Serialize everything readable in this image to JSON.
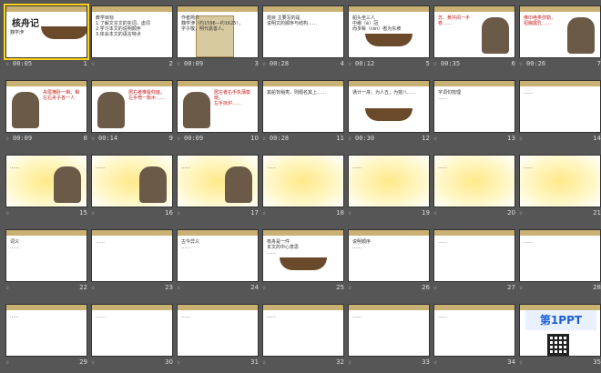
{
  "app": {
    "view": "Slide Sorter"
  },
  "slides": [
    {
      "n": "1",
      "time": "00:05",
      "lines": [
        "核舟记",
        "魏学洢"
      ],
      "style": "title"
    },
    {
      "n": "2",
      "time": "",
      "lines": [
        "教学目标",
        "1.了解文言文的实词、虚词",
        "2.学习本文的说明顺序",
        "3.体会本文的语言特点"
      ],
      "style": "list"
    },
    {
      "n": "3",
      "time": "00:09",
      "lines": [
        "作者简介",
        "魏学洢（约1596—约1625），",
        "字子敬，明代嘉善人。"
      ],
      "style": "scroll"
    },
    {
      "n": "4",
      "time": "00:28",
      "lines": [
        "题目 主要写的是",
        "说明文的顺序与结构……"
      ],
      "style": "list"
    },
    {
      "n": "5",
      "time": "00:12",
      "lines": [
        "船头坐三人",
        "中峨（é）冠",
        "而多髯（rán）者为东坡"
      ],
      "style": "boat"
    },
    {
      "n": "6",
      "time": "00:35",
      "lines": [
        "苏、黄共阅一手卷……"
      ],
      "style": "figure"
    },
    {
      "n": "7",
      "time": "00:26",
      "lines": [
        "佛印绝类弥勒，",
        "袒胸露乳……"
      ],
      "style": "figure"
    },
    {
      "n": "8",
      "time": "00:09",
      "lines": [
        "舟尾横卧一楫，楫左右舟子各一人"
      ],
      "style": "figureL"
    },
    {
      "n": "9",
      "time": "00:14",
      "lines": [
        "居右者椎髻仰面，",
        "左手倚一衡木……"
      ],
      "style": "figureL"
    },
    {
      "n": "10",
      "time": "00:09",
      "lines": [
        "居左者右手执蒲葵扇，",
        "左手抚炉……"
      ],
      "style": "figureL"
    },
    {
      "n": "11",
      "time": "00:28",
      "lines": [
        "其船背稍夷，则题名其上……"
      ],
      "style": "list"
    },
    {
      "n": "12",
      "time": "00:30",
      "lines": [
        "通计一舟，为人五；为窗八……"
      ],
      "style": "boat"
    },
    {
      "n": "13",
      "time": "",
      "lines": [
        "字词句梳理",
        "……"
      ],
      "style": "list"
    },
    {
      "n": "14",
      "time": "",
      "lines": [
        "……"
      ],
      "style": "list"
    },
    {
      "n": "15",
      "time": "",
      "lines": [
        "……"
      ],
      "style": "yellowFig"
    },
    {
      "n": "16",
      "time": "",
      "lines": [
        "……"
      ],
      "style": "yellowFig"
    },
    {
      "n": "17",
      "time": "",
      "lines": [
        "……"
      ],
      "style": "yellowFig"
    },
    {
      "n": "18",
      "time": "",
      "lines": [
        "……"
      ],
      "style": "yellow"
    },
    {
      "n": "19",
      "time": "",
      "lines": [
        "……"
      ],
      "style": "yellow"
    },
    {
      "n": "20",
      "time": "",
      "lines": [
        "……"
      ],
      "style": "yellow"
    },
    {
      "n": "21",
      "time": "",
      "lines": [
        "……"
      ],
      "style": "yellow"
    },
    {
      "n": "22",
      "time": "",
      "lines": [
        "词义",
        "……"
      ],
      "style": "list"
    },
    {
      "n": "23",
      "time": "",
      "lines": [
        "……"
      ],
      "style": "list"
    },
    {
      "n": "24",
      "time": "",
      "lines": [
        "古今异义",
        "……"
      ],
      "style": "list"
    },
    {
      "n": "25",
      "time": "",
      "lines": [
        "核舟是一件",
        "本文的中心意思",
        "……"
      ],
      "style": "boatBig"
    },
    {
      "n": "26",
      "time": "",
      "lines": [
        "说明顺序",
        "……"
      ],
      "style": "list"
    },
    {
      "n": "27",
      "time": "",
      "lines": [
        "……"
      ],
      "style": "list"
    },
    {
      "n": "28",
      "time": "",
      "lines": [
        "……"
      ],
      "style": "list"
    },
    {
      "n": "29",
      "time": "",
      "lines": [
        "……"
      ],
      "style": "list"
    },
    {
      "n": "30",
      "time": "",
      "lines": [
        "……"
      ],
      "style": "list"
    },
    {
      "n": "31",
      "time": "",
      "lines": [
        "……"
      ],
      "style": "list"
    },
    {
      "n": "32",
      "time": "",
      "lines": [
        "……"
      ],
      "style": "list"
    },
    {
      "n": "33",
      "time": "",
      "lines": [
        "……"
      ],
      "style": "list"
    },
    {
      "n": "34",
      "time": "",
      "lines": [
        "……"
      ],
      "style": "list"
    },
    {
      "n": "35",
      "time": "",
      "lines": [
        "第1PPT"
      ],
      "style": "logo"
    }
  ]
}
